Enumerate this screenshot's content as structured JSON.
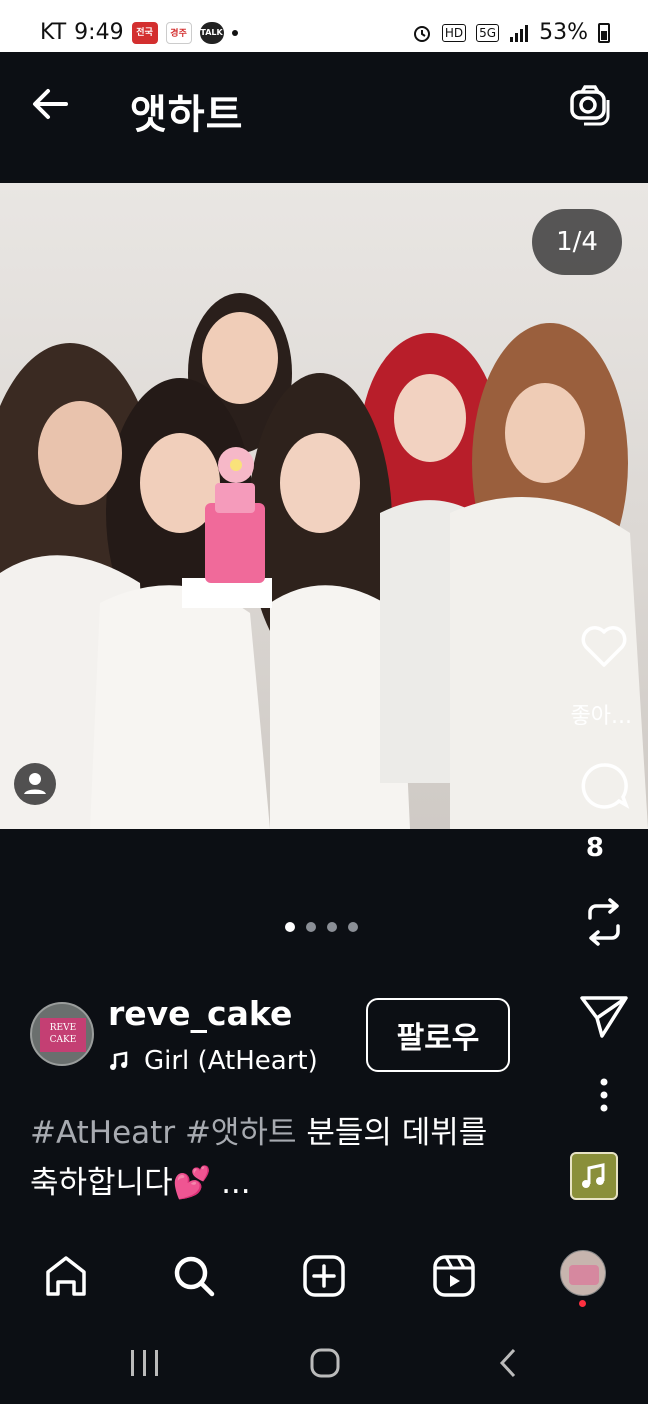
{
  "status_bar": {
    "carrier": "KT",
    "time": "9:49",
    "notif1": "전국",
    "notif2": "경주",
    "notif3": "TALK",
    "hd": "HD",
    "network": "5G",
    "battery": "53%"
  },
  "header": {
    "title": "앳하트"
  },
  "post": {
    "counter": "1/4",
    "like_label": "좋아...",
    "comment_count": "8",
    "page_total": 4,
    "page_current": 1
  },
  "account": {
    "username": "reve_cake",
    "song": "Girl (AtHeart)",
    "follow_label": "팔로우",
    "avatar_logo_line1": "REVE",
    "avatar_logo_line2": "CAKE"
  },
  "caption": {
    "tag1": "#AtHeatr",
    "tag2": "#앳하트",
    "text1": "분들의 데뷔를",
    "text2": "축하합니다💕",
    "more": "..."
  },
  "icons": {
    "back": "arrow-left-icon",
    "camera": "camera-icon",
    "heart": "heart-icon",
    "comment": "comment-icon",
    "repost": "repost-icon",
    "share": "send-icon",
    "more": "more-vertical-icon",
    "home": "home-icon",
    "search": "search-icon",
    "add": "add-icon",
    "reels": "reels-icon"
  },
  "colors": {
    "background": "#0c0f14",
    "hashtag": "#a7aab0",
    "notification_dot": "#ff3040"
  }
}
